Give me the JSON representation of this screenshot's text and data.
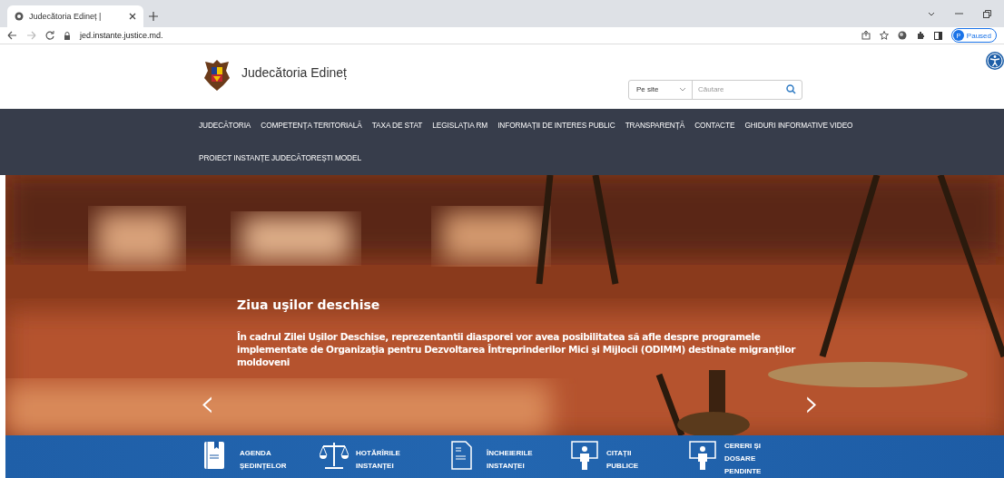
{
  "browser": {
    "tab_title": "Judecătoria Edineț |",
    "url": "jed.instante.justice.md.",
    "profile_initial": "P",
    "profile_status": "Paused"
  },
  "header": {
    "site_title": "Judecătoria Edineț",
    "search_scope": "Pe site",
    "search_placeholder": "Căutare"
  },
  "nav": {
    "rows": [
      [
        "JUDECĂTORIA",
        "COMPETENȚA TERITORIALĂ",
        "TAXA DE STAT",
        "LEGISLAȚIA RM",
        "INFORMAȚII DE INTERES PUBLIC",
        "TRANSPARENȚĂ",
        "CONTACTE",
        "GHIDURI INFORMATIVE VIDEO"
      ],
      [
        "PROIECT INSTANȚE JUDECĂTOREȘTI MODEL"
      ]
    ]
  },
  "hero": {
    "title": "Ziua uşilor deschise",
    "text": "În cadrul Zilei Uşilor Deschise, reprezentantii diasporei vor avea posibilitatea să afle despre programele implementate de Organizaţia pentru Dezvoltarea Întreprinderilor Mici şi Mijlocii (ODIMM) destinate migranţilor moldoveni",
    "prev": "‹",
    "next": "›"
  },
  "quick_links": [
    {
      "kind": "book",
      "lines": [
        "AGENDA",
        "ȘEDINȚELOR"
      ]
    },
    {
      "kind": "scales",
      "lines": [
        "HOTĂRÎRILE",
        "INSTANȚEI"
      ]
    },
    {
      "kind": "document",
      "lines": [
        "ÎNCHEIERILE",
        "INSTANȚEI"
      ]
    },
    {
      "kind": "speaker",
      "lines": [
        "CITAȚII",
        "PUBLICE"
      ]
    },
    {
      "kind": "speaker",
      "lines": [
        "CERERI ȘI",
        "DOSARE",
        "PENDINTE"
      ]
    }
  ]
}
